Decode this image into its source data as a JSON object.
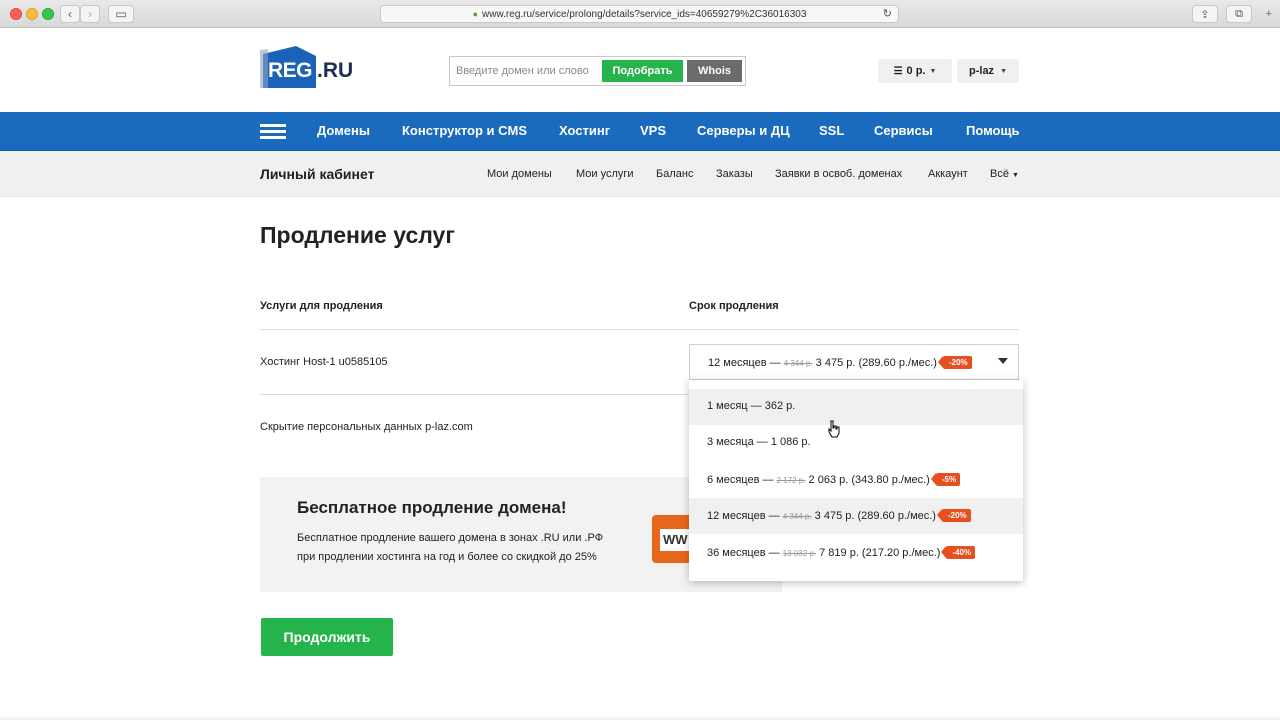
{
  "browser": {
    "url": "www.reg.ru/service/prolong/details?service_ids=40659279%2C36016303"
  },
  "header": {
    "logo_reg": "REG",
    "logo_ru": ".RU",
    "search_placeholder": "Введите домен или слово",
    "pick_button": "Подобрать",
    "whois_button": "Whois",
    "balance": "0 р.",
    "user": "p-laz"
  },
  "mainnav": {
    "items": [
      "Домены",
      "Конструктор и CMS",
      "Хостинг",
      "VPS",
      "Серверы и ДЦ",
      "SSL",
      "Сервисы",
      "Помощь"
    ]
  },
  "subnav": {
    "title": "Личный кабинет",
    "links": [
      "Мои домены",
      "Мои услуги",
      "Баланс",
      "Заказы",
      "Заявки в освоб. доменах",
      "Аккаунт",
      "Всё"
    ]
  },
  "page": {
    "title": "Продление услуг",
    "col_services": "Услуги для продления",
    "col_term": "Срок продления",
    "services": [
      "Хостинг Host-1 u0585105",
      "Скрытие персональных данных p-laz.com"
    ]
  },
  "select": {
    "selected": {
      "label": "12 месяцев — ",
      "old": "4 344 р.",
      "price": " 3 475 р. (289.60 р./мес.)",
      "badge": "-20%"
    },
    "options": [
      {
        "label": "1 месяц — 362 р.",
        "old": "",
        "price": "",
        "badge": ""
      },
      {
        "label": "3 месяца — 1 086 р.",
        "old": "",
        "price": "",
        "badge": ""
      },
      {
        "label": "6 месяцев — ",
        "old": "2 172 р.",
        "price": " 2 063 р. (343.80 р./мес.)",
        "badge": "-5%"
      },
      {
        "label": "12 месяцев — ",
        "old": "4 344 р.",
        "price": " 3 475 р. (289.60 р./мес.)",
        "badge": "-20%"
      },
      {
        "label": "36 месяцев — ",
        "old": "13 032 р.",
        "price": " 7 819 р. (217.20 р./мес.)",
        "badge": "-40%"
      }
    ]
  },
  "promo": {
    "title": "Бесплатное продление домена!",
    "line1": "Бесплатное продление вашего домена в зонах .RU или .РФ",
    "line2": "при продлении хостинга на год и более со скидкой до 25%",
    "illustration_text": "WW"
  },
  "continue_button": "Продолжить",
  "colors": {
    "brand_blue": "#1a6bbd",
    "green": "#25b34b",
    "badge": "#e65020"
  }
}
